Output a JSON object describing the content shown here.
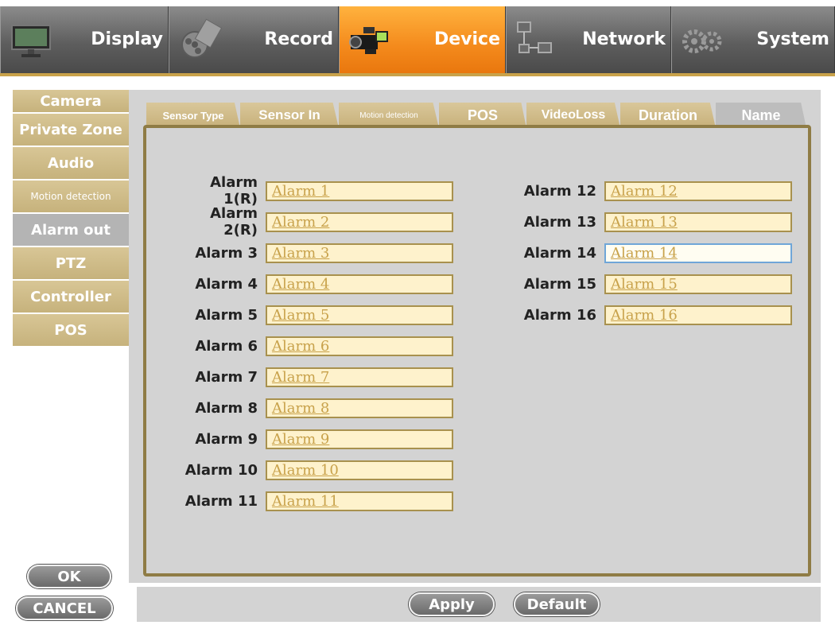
{
  "nav": {
    "display": "Display",
    "record": "Record",
    "device": "Device",
    "network": "Network",
    "system": "System"
  },
  "sidebar": {
    "items": [
      {
        "label": "Camera"
      },
      {
        "label": "Private Zone"
      },
      {
        "label": "Audio"
      },
      {
        "label": "Motion detection"
      },
      {
        "label": "Alarm out"
      },
      {
        "label": "PTZ"
      },
      {
        "label": "Controller"
      },
      {
        "label": "POS"
      }
    ],
    "active": "Alarm out"
  },
  "tabs": {
    "sensor_type": "Sensor Type",
    "sensor_in": "Sensor In",
    "motion_detection": "Motion detection",
    "pos": "POS",
    "videoloss": "VideoLoss",
    "duration": "Duration",
    "name": "Name",
    "active": "Name"
  },
  "alarms": {
    "left": [
      {
        "label": "Alarm 1(R)",
        "value": "Alarm 1"
      },
      {
        "label": "Alarm 2(R)",
        "value": "Alarm 2"
      },
      {
        "label": "Alarm 3",
        "value": "Alarm 3"
      },
      {
        "label": "Alarm 4",
        "value": "Alarm 4"
      },
      {
        "label": "Alarm 5",
        "value": "Alarm 5"
      },
      {
        "label": "Alarm 6",
        "value": "Alarm 6"
      },
      {
        "label": "Alarm 7",
        "value": "Alarm 7"
      },
      {
        "label": "Alarm 8",
        "value": "Alarm 8"
      },
      {
        "label": "Alarm 9",
        "value": "Alarm 9"
      },
      {
        "label": "Alarm 10",
        "value": "Alarm 10"
      },
      {
        "label": "Alarm 11",
        "value": "Alarm 11"
      }
    ],
    "right": [
      {
        "label": "Alarm 12",
        "value": "Alarm 12"
      },
      {
        "label": "Alarm 13",
        "value": "Alarm 13"
      },
      {
        "label": "Alarm 14",
        "value": "Alarm 14"
      },
      {
        "label": "Alarm 15",
        "value": "Alarm 15"
      },
      {
        "label": "Alarm 16",
        "value": "Alarm 16"
      }
    ],
    "focused": "Alarm 14"
  },
  "buttons": {
    "ok": "OK",
    "cancel": "CANCEL",
    "apply": "Apply",
    "default": "Default"
  },
  "colors": {
    "accent_orange": "#f48a1c",
    "tab_gold": "#c7b07a",
    "frame_border": "#8f7c45",
    "input_bg": "#fef2cc"
  },
  "icons": {
    "display": "monitor-icon",
    "record": "film-reel-icon",
    "device": "camcorder-icon",
    "network": "network-icon",
    "system": "gears-icon"
  }
}
